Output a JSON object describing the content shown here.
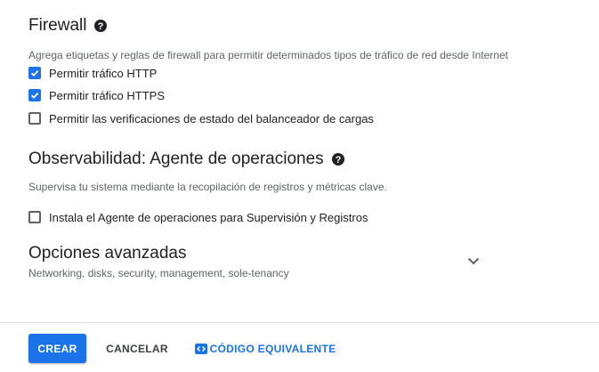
{
  "firewall": {
    "title": "Firewall",
    "help_icon": "help-circle-icon",
    "description": "Agrega etiquetas y reglas de firewall para permitir determinados tipos de tráfico de red desde Internet",
    "options": [
      {
        "label": "Permitir tráfico HTTP",
        "checked": true
      },
      {
        "label": "Permitir tráfico HTTPS",
        "checked": true
      },
      {
        "label": "Permitir las verificaciones de estado del balanceador de cargas",
        "checked": false
      }
    ]
  },
  "observability": {
    "title": "Observabilidad: Agente de operaciones",
    "help_icon": "help-circle-icon",
    "description": "Supervisa tu sistema mediante la recopilación de registros y métricas clave.",
    "option": {
      "label": "Instala el Agente de operaciones para Supervisión y Registros",
      "checked": false
    }
  },
  "advanced": {
    "title": "Opciones avanzadas",
    "subtitle": "Networking, disks, security, management, sole-tenancy",
    "expand_icon": "chevron-down-icon"
  },
  "footer": {
    "create_label": "CREAR",
    "cancel_label": "CANCELAR",
    "code_label": "CÓDIGO EQUIVALENTE",
    "code_icon": "code-icon"
  },
  "colors": {
    "accent": "#1a73e8",
    "text_primary": "#202124",
    "text_secondary": "#5f6368",
    "divider": "#e0e0e0"
  }
}
